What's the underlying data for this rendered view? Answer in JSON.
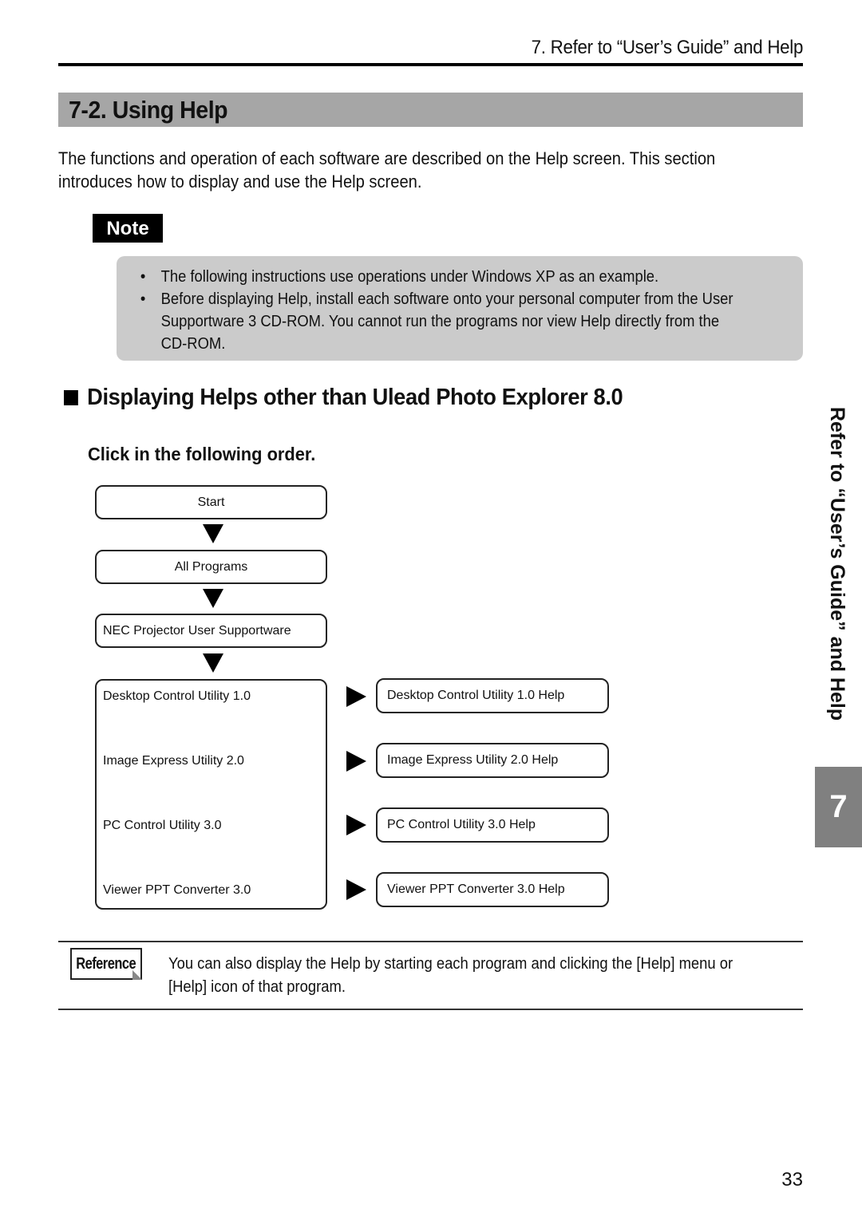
{
  "header": {
    "running_title": "7. Refer to “User’s Guide” and Help"
  },
  "section": {
    "title": "7-2. Using Help",
    "intro_line1": "The functions and operation of each software are described on the Help screen.  This section",
    "intro_line2": "introduces how to display and use the Help screen."
  },
  "note": {
    "label": "Note",
    "bullet_glyph": "•",
    "items": [
      {
        "line1": "The following instructions use operations under Windows XP as an example."
      },
      {
        "line1": "Before displaying Help, install each software onto your personal computer from the User",
        "line2": "Supportware 3 CD-ROM.  You cannot run the programs nor view Help directly from the",
        "line3": "CD-ROM."
      }
    ]
  },
  "subsection": {
    "title": "Displaying Helps other than Ulead Photo Explorer 8.0",
    "order_heading": "Click in the following order."
  },
  "flow": {
    "steps": [
      "Start",
      "All Programs",
      "NEC Projector User Supportware"
    ],
    "programs": [
      {
        "name": "Desktop Control Utility 1.0",
        "help": "Desktop Control Utility 1.0 Help"
      },
      {
        "name": "Image Express Utility 2.0",
        "help": "Image Express Utility 2.0 Help"
      },
      {
        "name": "PC Control Utility 3.0",
        "help": "PC Control Utility 3.0 Help"
      },
      {
        "name": "Viewer PPT Converter 3.0",
        "help": "Viewer PPT Converter 3.0 Help"
      }
    ]
  },
  "reference": {
    "icon_label": "Reference",
    "line1": "You can also display the Help by starting each program and clicking the [Help] menu or",
    "line2": "[Help] icon of that program."
  },
  "side_tab": {
    "title": "Refer to “User’s Guide” and Help",
    "chapter": "7"
  },
  "footer": {
    "page_number": "33"
  }
}
